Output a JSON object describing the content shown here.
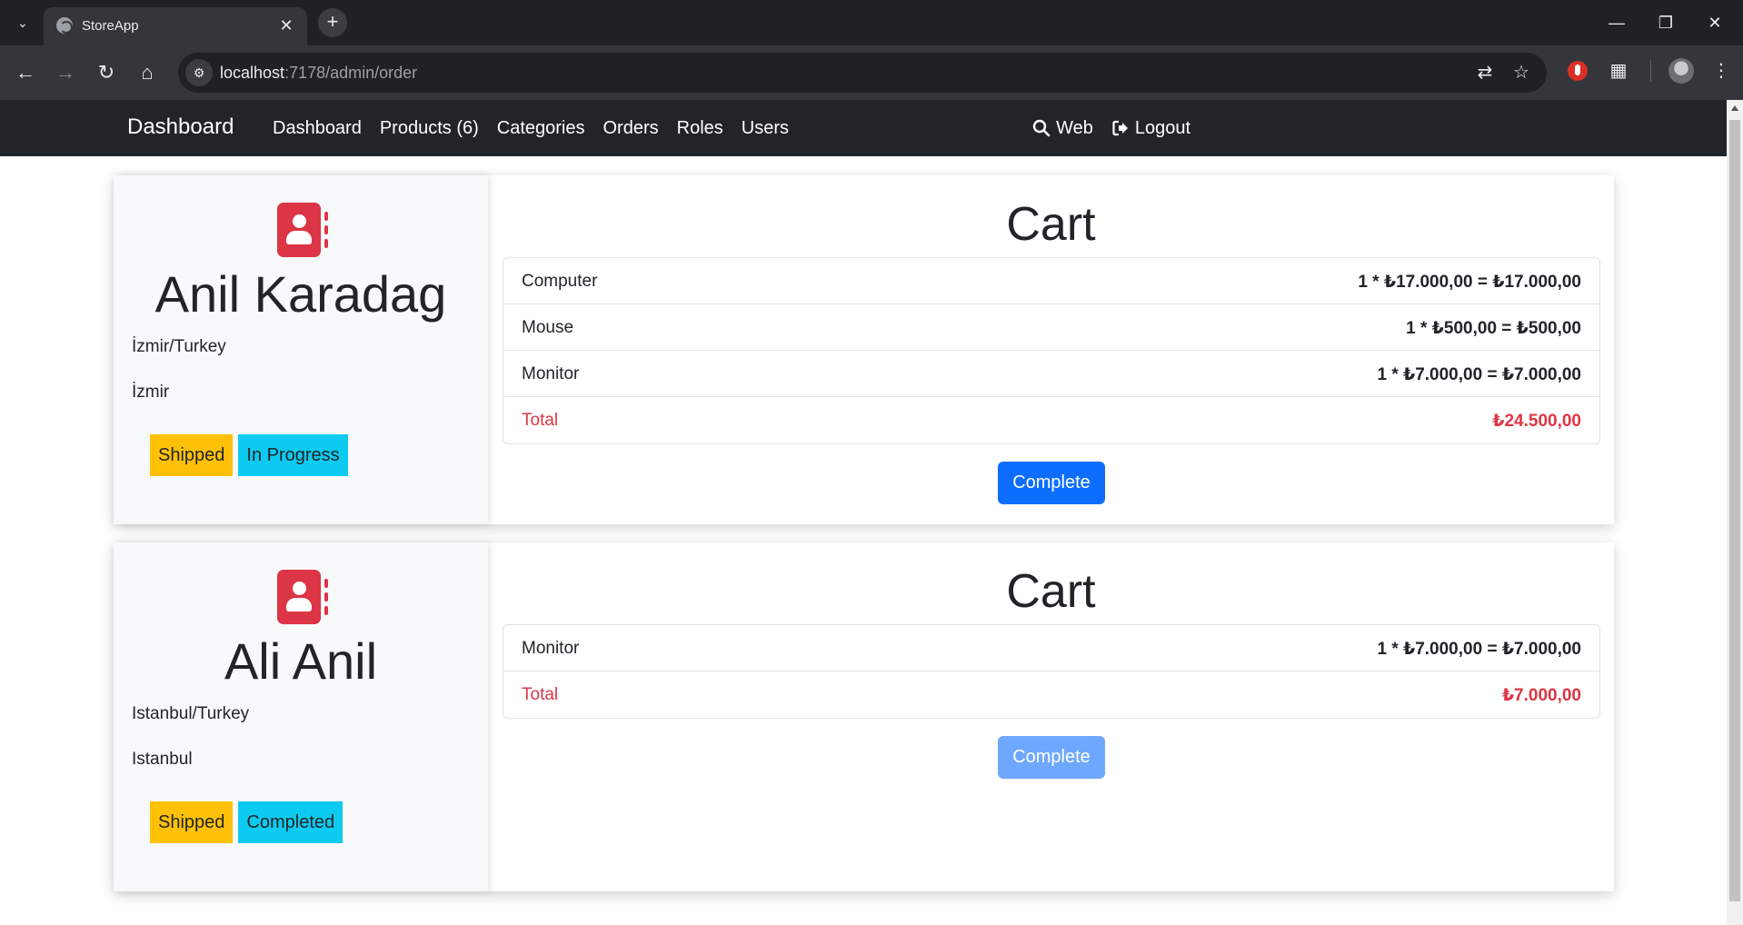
{
  "browser": {
    "tab_title": "StoreApp",
    "url_host": "localhost",
    "url_path": ":7178/admin/order"
  },
  "navbar": {
    "brand": "Dashboard",
    "links": [
      "Dashboard",
      "Products (6)",
      "Categories",
      "Orders",
      "Roles",
      "Users"
    ],
    "web_label": "Web",
    "logout_label": "Logout"
  },
  "orders": [
    {
      "customer_name": "Anil Karadag",
      "address_line": "İzmir/Turkey",
      "city": "İzmir",
      "badge_shipped": "Shipped",
      "badge_status": "In Progress",
      "cart_title": "Cart",
      "items": [
        {
          "name": "Computer",
          "calc": "1 * ₺17.000,00 = ₺17.000,00"
        },
        {
          "name": "Mouse",
          "calc": "1 * ₺500,00 = ₺500,00"
        },
        {
          "name": "Monitor",
          "calc": "1 * ₺7.000,00 = ₺7.000,00"
        }
      ],
      "total_label": "Total",
      "total_value": "₺24.500,00",
      "button_label": "Complete",
      "button_enabled": true
    },
    {
      "customer_name": "Ali Anil",
      "address_line": "Istanbul/Turkey",
      "city": "Istanbul",
      "badge_shipped": "Shipped",
      "badge_status": "Completed",
      "cart_title": "Cart",
      "items": [
        {
          "name": "Monitor",
          "calc": "1 * ₺7.000,00 = ₺7.000,00"
        }
      ],
      "total_label": "Total",
      "total_value": "₺7.000,00",
      "button_label": "Complete",
      "button_enabled": false
    }
  ],
  "colors": {
    "primary": "#0d6efd",
    "danger": "#dc3545",
    "warning": "#ffc107",
    "info": "#0dcaf0",
    "navbar": "#212529"
  }
}
